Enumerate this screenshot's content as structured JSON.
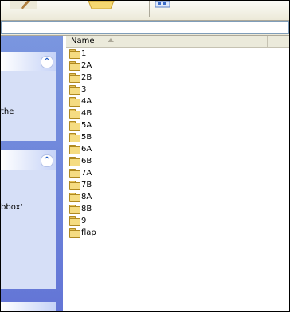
{
  "taskpane": {
    "panels": [
      {
        "text": "the",
        "chevron": "^"
      },
      {
        "text": "bbox'",
        "chevron": "^"
      }
    ]
  },
  "filelist": {
    "column_name": "Name",
    "items": [
      "1",
      "2A",
      "2B",
      "3",
      "4A",
      "4B",
      "5A",
      "5B",
      "6A",
      "6B",
      "7A",
      "7B",
      "8A",
      "8B",
      "9",
      "flap"
    ]
  },
  "icons": {
    "edit": "pencil-icon",
    "folder": "folder-icon",
    "views": "views-icon",
    "chevron": "double-chevron-up-icon"
  }
}
